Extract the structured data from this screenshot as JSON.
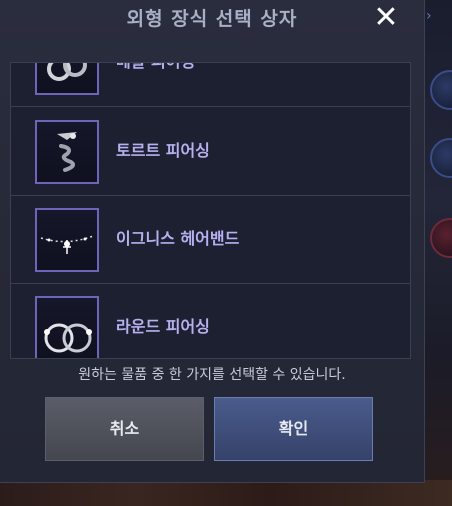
{
  "dialog": {
    "title": "외형 장식 선택 상자",
    "close_icon": "close-icon",
    "notice": "원하는 물품 중 한 가지를 선택할 수 있습니다.",
    "cancel_label": "취소",
    "confirm_label": "확인"
  },
  "items": [
    {
      "name": "메탈 피어싱",
      "icon": "metal-piercing-icon"
    },
    {
      "name": "토르트 피어싱",
      "icon": "tort-piercing-icon"
    },
    {
      "name": "이그니스 헤어밴드",
      "icon": "ignis-hairband-icon"
    },
    {
      "name": "라운드 피어싱",
      "icon": "round-piercing-icon"
    }
  ],
  "colors": {
    "item_name": "#b7b0f0",
    "thumb_border": "#6f64b8",
    "confirm_button": "#4a5b8c",
    "cancel_button": "#5a5d68"
  }
}
